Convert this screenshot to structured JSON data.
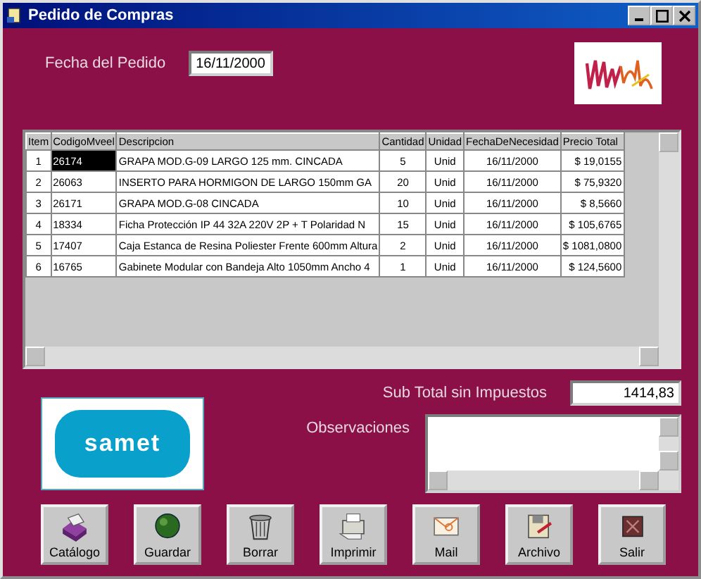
{
  "window": {
    "title": "Pedido de Compras"
  },
  "order_date": {
    "label": "Fecha del Pedido",
    "value": "16/11/2000"
  },
  "table": {
    "columns": [
      "Item",
      "CodigoMveel",
      "Descripcion",
      "Cantidad",
      "Unidad",
      "FechaDeNecesidad",
      "Precio Total"
    ],
    "rows": [
      {
        "cells": [
          "1",
          "26174",
          "GRAPA MOD.G-09 LARGO 125 mm. CINCADA",
          "5",
          "Unid",
          "16/11/2000",
          "$ 19,0155"
        ],
        "code_focused": true
      },
      {
        "cells": [
          "2",
          "26063",
          "INSERTO PARA HORMIGON DE LARGO 150mm GA",
          "20",
          "Unid",
          "16/11/2000",
          "$ 75,9320"
        ],
        "code_focused": false
      },
      {
        "cells": [
          "3",
          "26171",
          "GRAPA MOD.G-08 CINCADA",
          "10",
          "Unid",
          "16/11/2000",
          "$ 8,5660"
        ],
        "code_focused": false
      },
      {
        "cells": [
          "4",
          "18334",
          "Ficha Protección IP 44  32A 220V 2P + T Polaridad N",
          "15",
          "Unid",
          "16/11/2000",
          "$ 105,6765"
        ],
        "code_focused": false
      },
      {
        "cells": [
          "5",
          "17407",
          "Caja Estanca de Resina Poliester Frente 600mm Altura",
          "2",
          "Unid",
          "16/11/2000",
          "$ 1081,0800"
        ],
        "code_focused": false
      },
      {
        "cells": [
          "6",
          "16765",
          "Gabinete Modular con Bandeja Alto 1050mm Ancho 4",
          "1",
          "Unid",
          "16/11/2000",
          "$ 124,5600"
        ],
        "code_focused": false
      }
    ]
  },
  "subtotal": {
    "label": "Sub Total sin Impuestos",
    "value": "1414,83"
  },
  "observations": {
    "label": "Observaciones"
  },
  "brand_logo": {
    "text": "samet"
  },
  "buttons": [
    {
      "label": "Catálogo"
    },
    {
      "label": "Guardar"
    },
    {
      "label": "Borrar"
    },
    {
      "label": "Imprimir"
    },
    {
      "label": "Mail"
    },
    {
      "label": "Archivo"
    },
    {
      "label": "Salir"
    }
  ]
}
